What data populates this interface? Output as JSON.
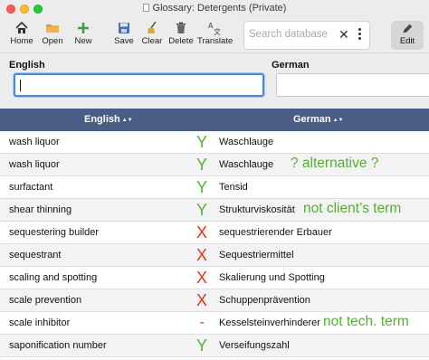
{
  "window": {
    "title": "Glossary: Detergents  (Private)"
  },
  "toolbar": {
    "home": "Home",
    "open": "Open",
    "new": "New",
    "save": "Save",
    "clear": "Clear",
    "delete": "Delete",
    "translate": "Translate",
    "edit": "Edit",
    "search_placeholder": "Search database"
  },
  "fields": {
    "english_label": "English",
    "german_label": "German",
    "english_value": "",
    "german_value": ""
  },
  "table": {
    "columns": {
      "english": "English",
      "german": "German"
    },
    "sort_glyph": "▲▼",
    "rows": [
      {
        "en": "wash liquor",
        "status": "Y",
        "de": "Waschlauge",
        "note": ""
      },
      {
        "en": "wash liquor",
        "status": "Y",
        "de": "Waschlauge",
        "note": "? alternative ?"
      },
      {
        "en": "surfactant",
        "status": "Y",
        "de": "Tensid",
        "note": ""
      },
      {
        "en": "shear thinning",
        "status": "Y",
        "de": "Strukturviskosität",
        "note": "not client’s term"
      },
      {
        "en": "sequestering builder",
        "status": "X",
        "de": "sequestrierender Erbauer",
        "note": ""
      },
      {
        "en": "sequestrant",
        "status": "X",
        "de": "Sequestriermittel",
        "note": ""
      },
      {
        "en": "scaling and spotting",
        "status": "X",
        "de": "Skalierung und Spotting",
        "note": ""
      },
      {
        "en": "scale prevention",
        "status": "X",
        "de": "Schuppenprävention",
        "note": ""
      },
      {
        "en": "scale inhibitor",
        "status": "-",
        "de": "Kesselsteinverhinderer",
        "note": "not tech. term"
      },
      {
        "en": "saponification number",
        "status": "Y",
        "de": "Verseifungszahl",
        "note": ""
      }
    ]
  },
  "colors": {
    "header_bg": "#4a5d84",
    "ok": "#5ab03a",
    "bad": "#e0331f",
    "note": "#56ad32"
  }
}
